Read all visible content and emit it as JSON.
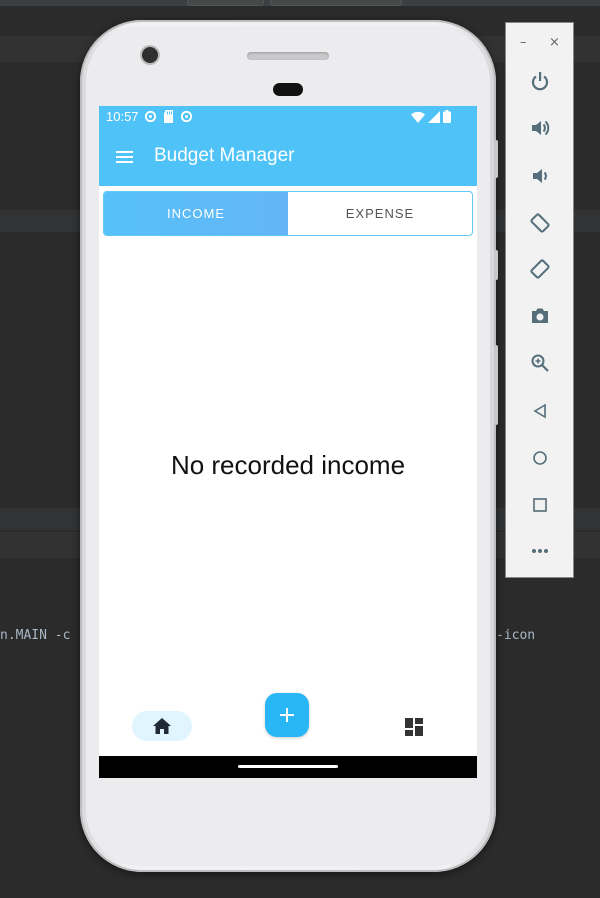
{
  "ide": {
    "left_text": "n.MAIN -c",
    "right_text": "-icon"
  },
  "status_bar": {
    "time": "10:57"
  },
  "app": {
    "title": "Budget Manager",
    "accent_color": "#4fc3f7"
  },
  "tabs": [
    {
      "label": "INCOME",
      "active": true
    },
    {
      "label": "EXPENSE",
      "active": false
    }
  ],
  "main": {
    "empty_message": "No recorded income"
  },
  "bottom_nav": {
    "items": [
      "home-icon",
      "add-icon",
      "dashboard-icon"
    ],
    "fab_symbol": "+"
  },
  "emulator": {
    "minimize_label": "–",
    "close_label": "×",
    "controls": [
      "power-icon",
      "volume-up-icon",
      "volume-down-icon",
      "rotate-left-icon",
      "rotate-right-icon",
      "screenshot-icon",
      "zoom-icon",
      "back-icon",
      "home-icon",
      "overview-icon",
      "more-icon"
    ]
  }
}
